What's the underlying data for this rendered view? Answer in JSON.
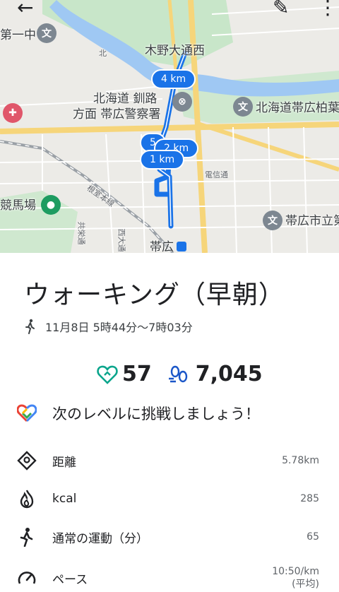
{
  "map": {
    "labels": {
      "daiichu": "第一中",
      "kinodori": "木野大通西",
      "hokkaido_kushiro": "北海道 釧路",
      "houmen_obihiro_police": "方面 帯広警察署",
      "hokkaido_obihiro_kashiwa": "北海道帯広柏葉",
      "keibajo": "競馬場",
      "nemuro_honsen": "根室本線",
      "obihiro_shiritsu": "帯広市立第",
      "obihiro_station": "帯広",
      "denshin": "電信通",
      "kita": "北",
      "kyoei": "共栄通",
      "nishi_odori": "西大通"
    },
    "km_markers": [
      "4 km",
      "5",
      "2 km",
      "1 km"
    ]
  },
  "activity": {
    "title": "ウォーキング（早朝）",
    "datetime": "11月8日 5時44分〜7時03分",
    "heart_points": "57",
    "steps": "7,045",
    "challenge": "次のレベルに挑戦しましょう！"
  },
  "metrics": [
    {
      "icon": "distance-icon",
      "label": "距離",
      "value": "5.78km"
    },
    {
      "icon": "fire-icon",
      "label": "kcal",
      "value": "285"
    },
    {
      "icon": "walk-icon",
      "label": "通常の運動（分）",
      "value": "65"
    },
    {
      "icon": "speedometer-icon",
      "label": "ペース",
      "value": "10:50/km",
      "value_sub": "(平均)"
    }
  ],
  "colors": {
    "route": "#1a73e8",
    "heart": "#0aa58c",
    "steps": "#1a56c8"
  }
}
